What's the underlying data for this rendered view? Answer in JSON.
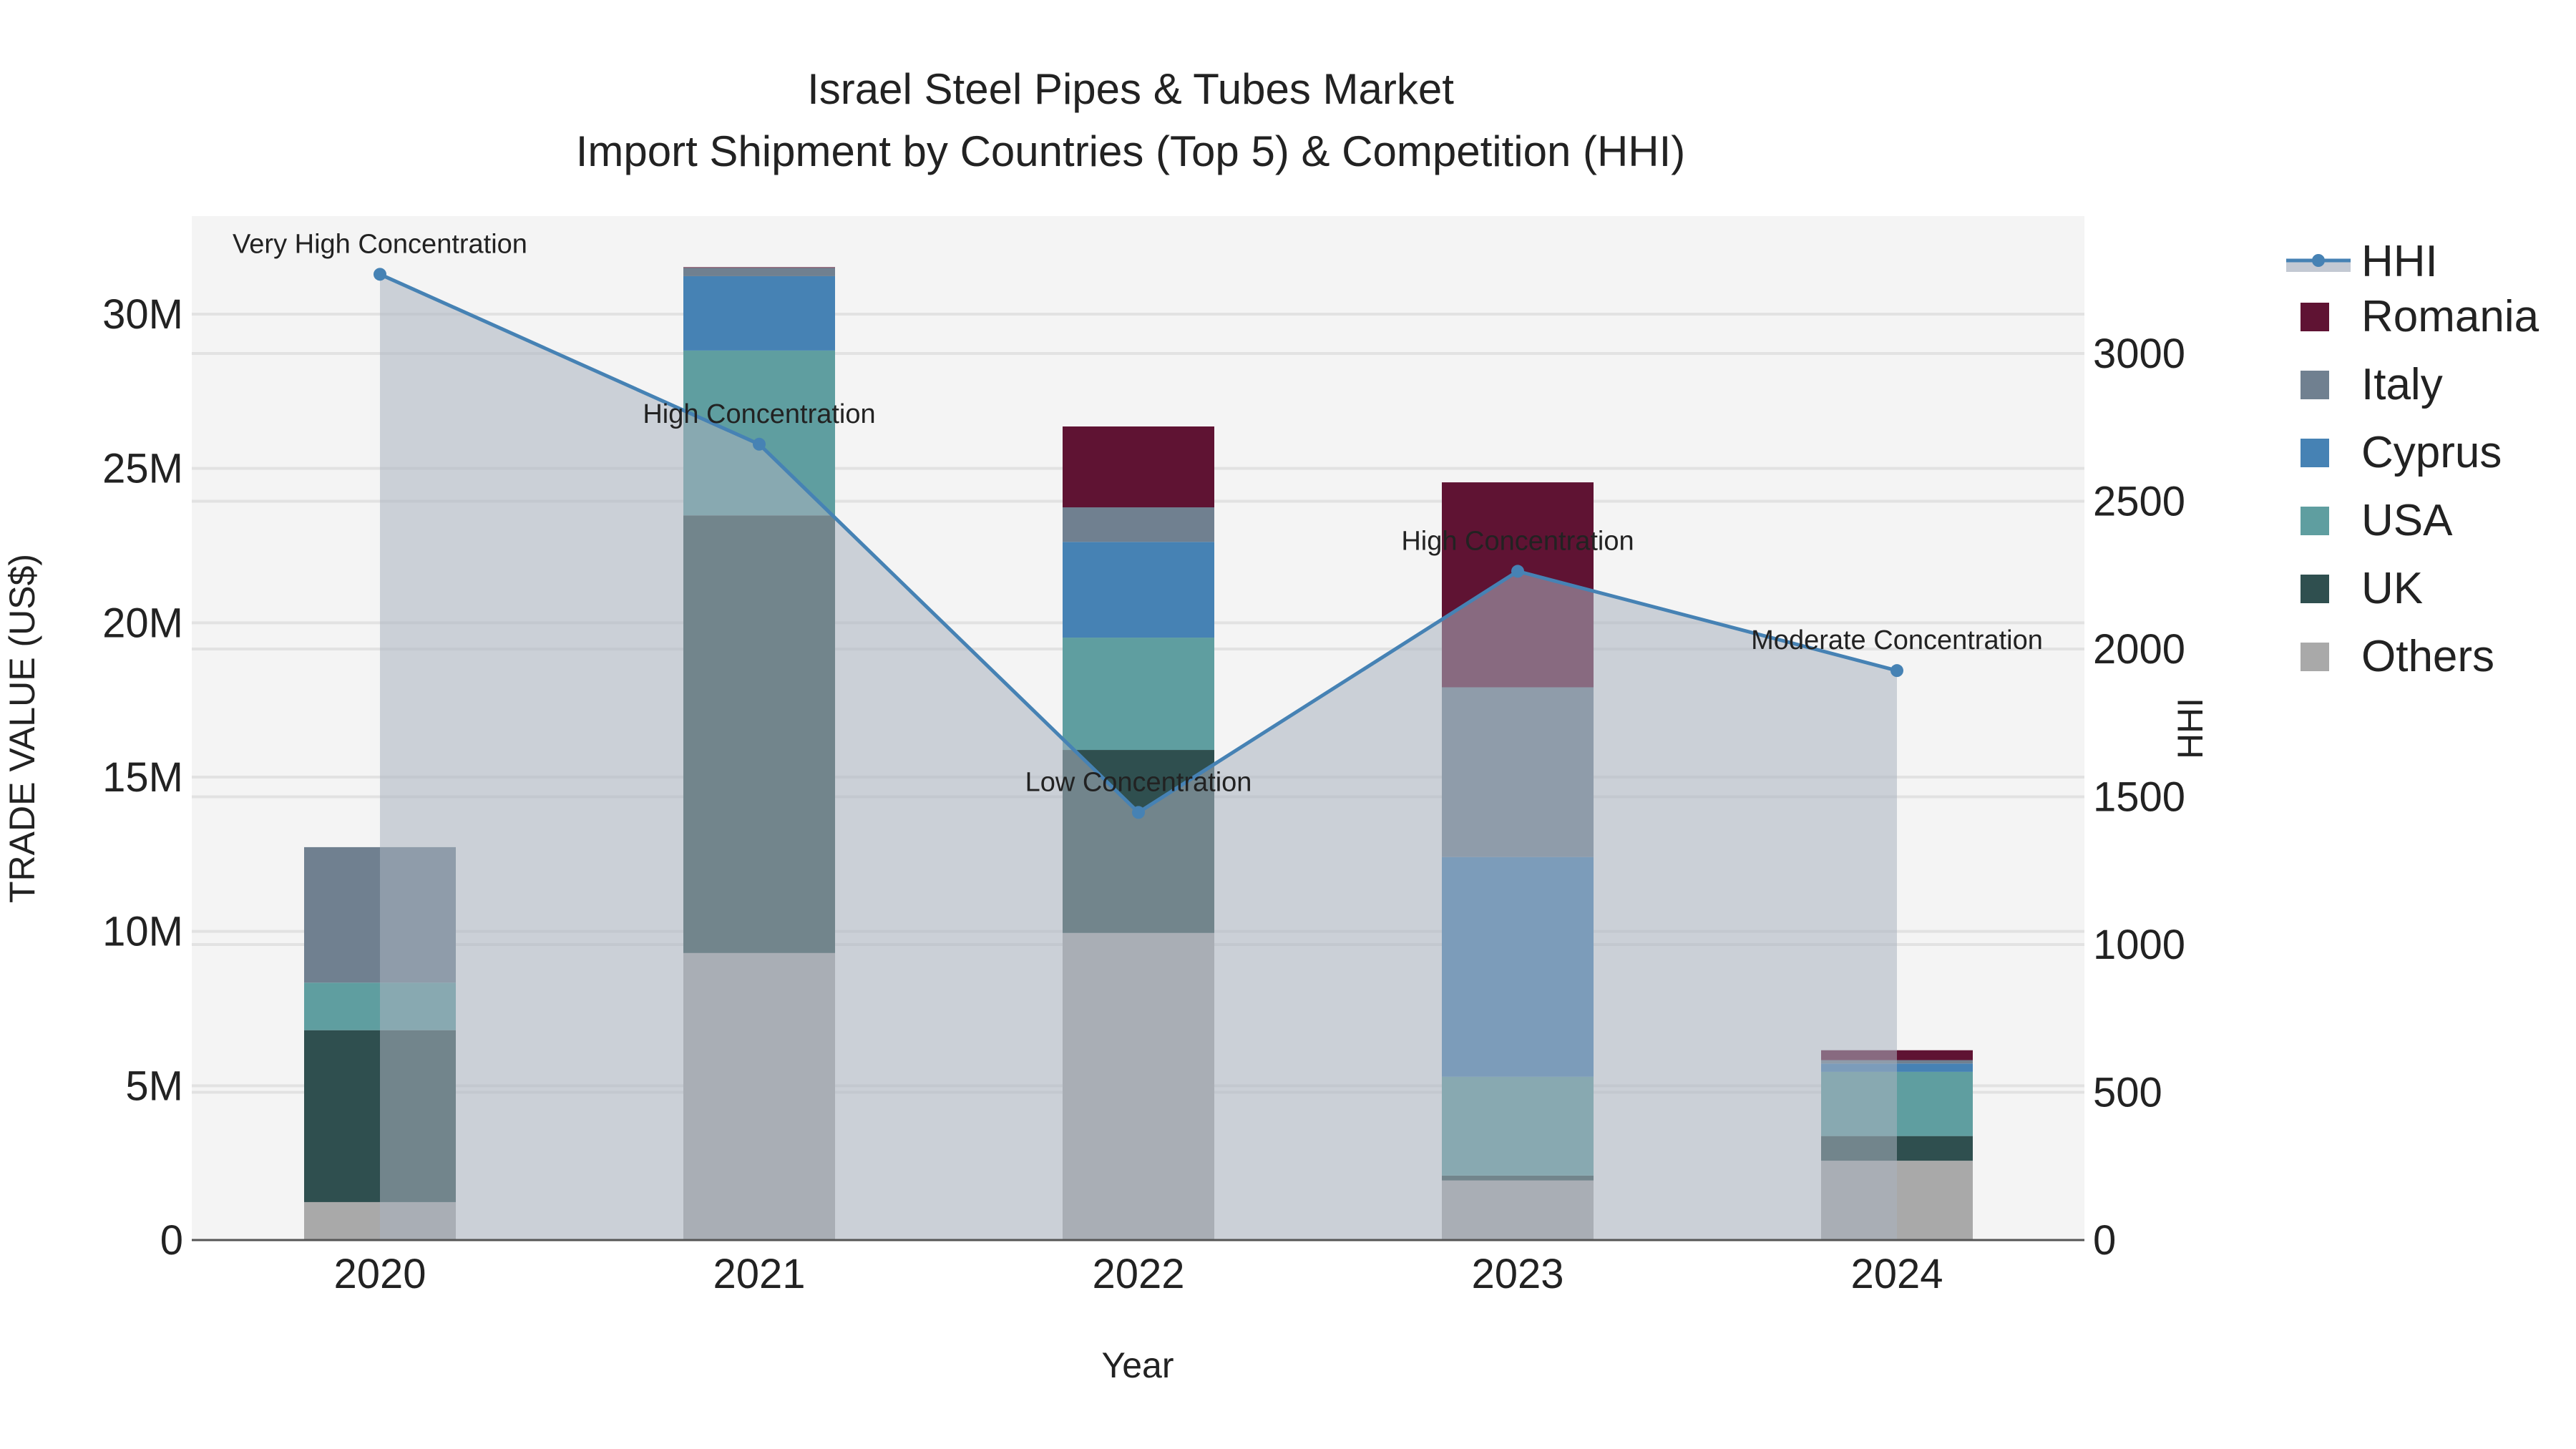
{
  "chart_data": {
    "type": "bar",
    "title_line1": "Israel Steel Pipes & Tubes Market",
    "title_line2": "Import Shipment by Countries (Top 5) & Competition (HHI)",
    "xlabel": "Year",
    "ylabel": "TRADE VALUE (US$)",
    "y2label": "HHI",
    "categories": [
      "2020",
      "2021",
      "2022",
      "2023",
      "2024"
    ],
    "ylim": [
      0,
      33000000
    ],
    "y2lim": [
      0,
      3450
    ],
    "yticks": [
      {
        "value": 0,
        "label": "0"
      },
      {
        "value": 5000000,
        "label": "5M"
      },
      {
        "value": 10000000,
        "label": "10M"
      },
      {
        "value": 15000000,
        "label": "15M"
      },
      {
        "value": 20000000,
        "label": "20M"
      },
      {
        "value": 25000000,
        "label": "25M"
      },
      {
        "value": 30000000,
        "label": "30M"
      }
    ],
    "y2ticks": [
      {
        "value": 0,
        "label": "0"
      },
      {
        "value": 500,
        "label": "500"
      },
      {
        "value": 1000,
        "label": "1000"
      },
      {
        "value": 1500,
        "label": "1500"
      },
      {
        "value": 2000,
        "label": "2000"
      },
      {
        "value": 2500,
        "label": "2500"
      },
      {
        "value": 3000,
        "label": "3000"
      }
    ],
    "grid": true,
    "legend_position": "right",
    "series": [
      {
        "name": "Others",
        "color": "#a9a9a9",
        "values": [
          1230000,
          9300000,
          9950000,
          1930000,
          2570000
        ]
      },
      {
        "name": "UK",
        "color": "#2f4f4f",
        "values": [
          5570000,
          14180000,
          5930000,
          160000,
          800000
        ]
      },
      {
        "name": "USA",
        "color": "#5f9ea0",
        "values": [
          1540000,
          5340000,
          3640000,
          3200000,
          2080000
        ]
      },
      {
        "name": "Cyprus",
        "color": "#4682b4",
        "values": [
          0,
          2410000,
          3100000,
          7120000,
          270000
        ]
      },
      {
        "name": "Italy",
        "color": "#708090",
        "values": [
          4390000,
          270000,
          1120000,
          5500000,
          110000
        ]
      },
      {
        "name": "Romania",
        "color": "#5f1333",
        "values": [
          0,
          20000,
          2620000,
          6640000,
          320000
        ]
      }
    ],
    "hhi": {
      "name": "HHI",
      "color": "#4682b4",
      "values": [
        3268,
        2693,
        1447,
        2263,
        1927
      ],
      "annotations": [
        "Very High Concentration",
        "High Concentration",
        "Low Concentration",
        "High Concentration",
        "Moderate Concentration"
      ]
    },
    "legend_order": [
      "HHI",
      "Romania",
      "Italy",
      "Cyprus",
      "USA",
      "UK",
      "Others"
    ]
  }
}
